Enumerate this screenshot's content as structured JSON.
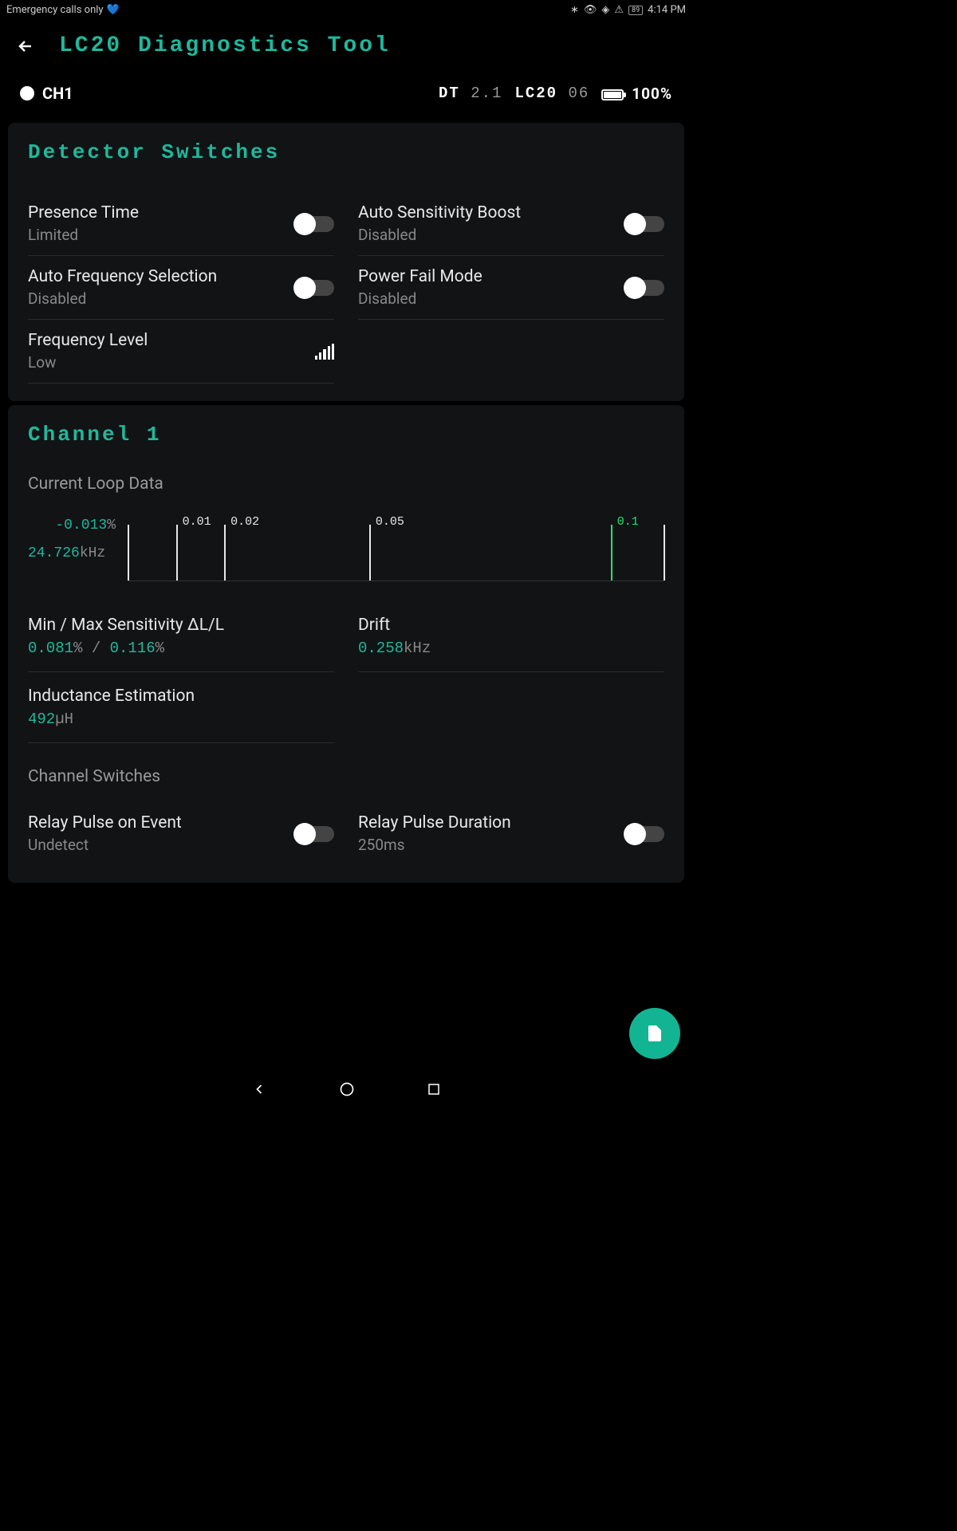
{
  "status_bar": {
    "left_text": "Emergency calls only",
    "battery_pct": "89",
    "time": "4:14 PM"
  },
  "header": {
    "title": "LC20 Diagnostics Tool"
  },
  "info": {
    "channel": "CH1",
    "dt_label": "DT",
    "dt_val": "2.1",
    "lc20_label": "LC20",
    "lc20_val": "06",
    "battery": "100%"
  },
  "detector": {
    "title": "Detector Switches",
    "items": [
      {
        "label": "Presence Time",
        "sub": "Limited",
        "type": "toggle"
      },
      {
        "label": "Auto Sensitivity Boost",
        "sub": "Disabled",
        "type": "toggle"
      },
      {
        "label": "Auto Frequency Selection",
        "sub": "Disabled",
        "type": "toggle"
      },
      {
        "label": "Power Fail Mode",
        "sub": "Disabled",
        "type": "toggle"
      },
      {
        "label": "Frequency Level",
        "sub": "Low",
        "type": "signal"
      }
    ]
  },
  "channel1": {
    "title": "Channel 1",
    "loop_title": "Current Loop Data",
    "reading_pct": "-0.013",
    "reading_pct_unit": "%",
    "reading_freq": "24.726",
    "reading_freq_unit": "kHz",
    "ticks": [
      {
        "pos": 0,
        "label": ""
      },
      {
        "pos": 9,
        "label": "0.01"
      },
      {
        "pos": 18,
        "label": "0.02"
      },
      {
        "pos": 45,
        "label": "0.05"
      },
      {
        "pos": 90,
        "label": "0.1",
        "green": true
      },
      {
        "pos": 99.8,
        "label": ""
      }
    ],
    "sensitivity_label": "Min / Max Sensitivity ΔL/L",
    "sensitivity_min": "0.081",
    "sensitivity_sep": "% / ",
    "sensitivity_max": "0.116",
    "sensitivity_unit": "%",
    "drift_label": "Drift",
    "drift_val": "0.258",
    "drift_unit": "kHz",
    "inductance_label": "Inductance Estimation",
    "inductance_val": "492",
    "inductance_unit": "µH",
    "ch_switches_title": "Channel Switches",
    "sw1_label": "Relay Pulse on Event",
    "sw1_sub": "Undetect",
    "sw2_label": "Relay Pulse Duration",
    "sw2_sub": "250ms"
  }
}
